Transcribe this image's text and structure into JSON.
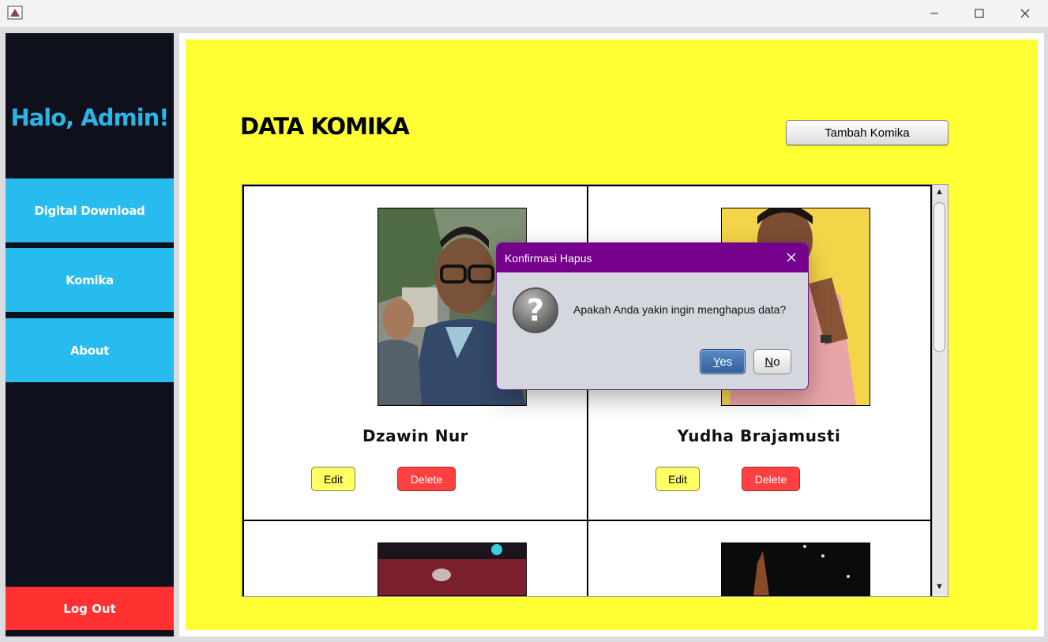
{
  "window": {
    "minimize_icon": "minimize-icon",
    "maximize_icon": "maximize-icon",
    "close_icon": "close-icon"
  },
  "sidebar": {
    "greeting": "Halo, Admin!",
    "items": [
      {
        "label": "Digital Download"
      },
      {
        "label": "Komika"
      },
      {
        "label": "About"
      }
    ],
    "logout_label": "Log Out"
  },
  "main": {
    "title": "DATA KOMIKA",
    "add_button": "Tambah Komika",
    "cards": [
      {
        "name": "Dzawin Nur",
        "edit_label": "Edit",
        "delete_label": "Delete"
      },
      {
        "name": "Yudha Brajamusti",
        "edit_label": "Edit",
        "delete_label": "Delete"
      }
    ]
  },
  "dialog": {
    "title": "Konfirmasi Hapus",
    "message": "Apakah Anda yakin ingin menghapus data?",
    "yes_label": "Yes",
    "no_label": "No",
    "icon": "question-icon"
  },
  "colors": {
    "sidebar_bg": "#0e111b",
    "nav_bg": "#27bbee",
    "logout_bg": "#ff3131",
    "main_bg": "#ffff33",
    "dialog_title_bg": "#74008b"
  }
}
